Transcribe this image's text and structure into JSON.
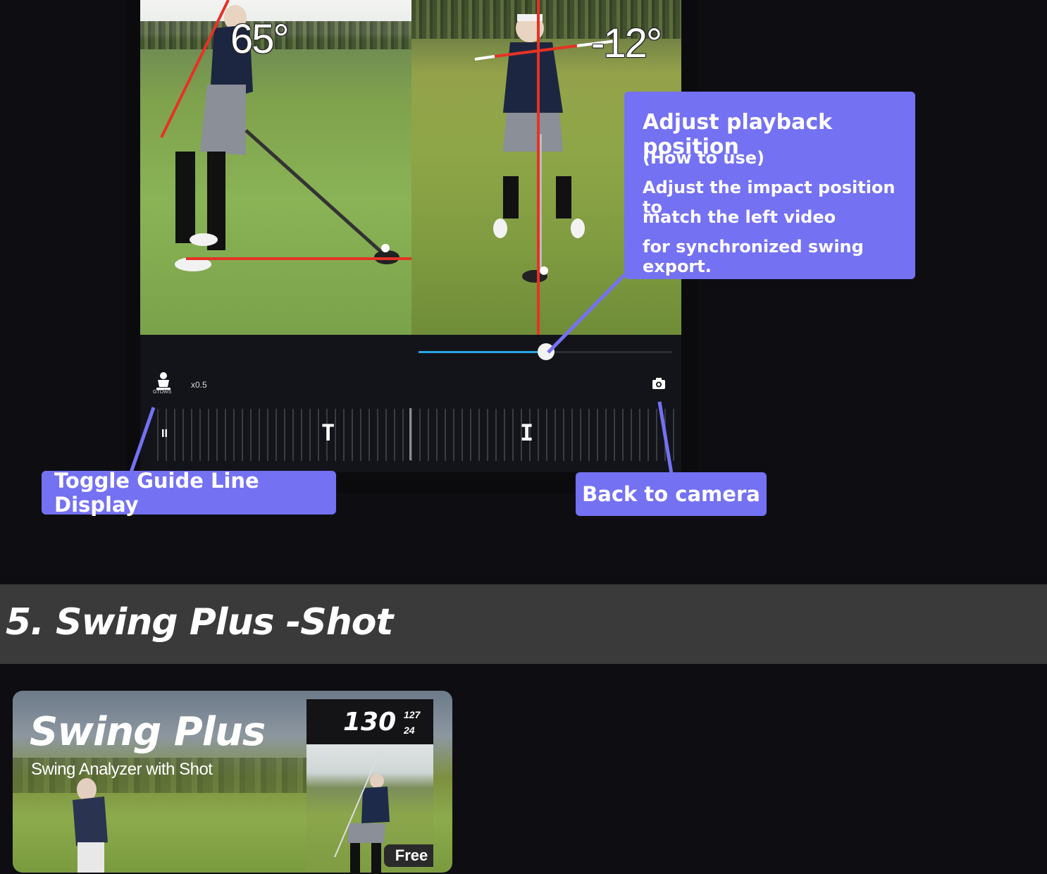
{
  "video": {
    "left_angle": "65°",
    "right_angle": "-12°"
  },
  "controls": {
    "guide_icon_caption": "GTOWS",
    "speed": "x0.5",
    "pause_symbol": "II",
    "marker_top": "T",
    "marker_impact": "I",
    "accent_color": "#2aa4e6"
  },
  "callouts": {
    "playback": {
      "title": "Adjust playback position",
      "line1": "(How to use)",
      "line2": "Adjust the impact position to",
      "line3": "match the left video",
      "line4": "for synchronized swing export."
    },
    "guide": "Toggle Guide Line Display",
    "camera": "Back to camera",
    "color": "#7471f3"
  },
  "section": {
    "title": "5. Swing Plus -Shot"
  },
  "banner": {
    "title": "Swing Plus",
    "subtitle": "Swing Analyzer with Shot",
    "distance": "130",
    "side_top": "127",
    "side_bottom": "24",
    "badge": "Free"
  }
}
